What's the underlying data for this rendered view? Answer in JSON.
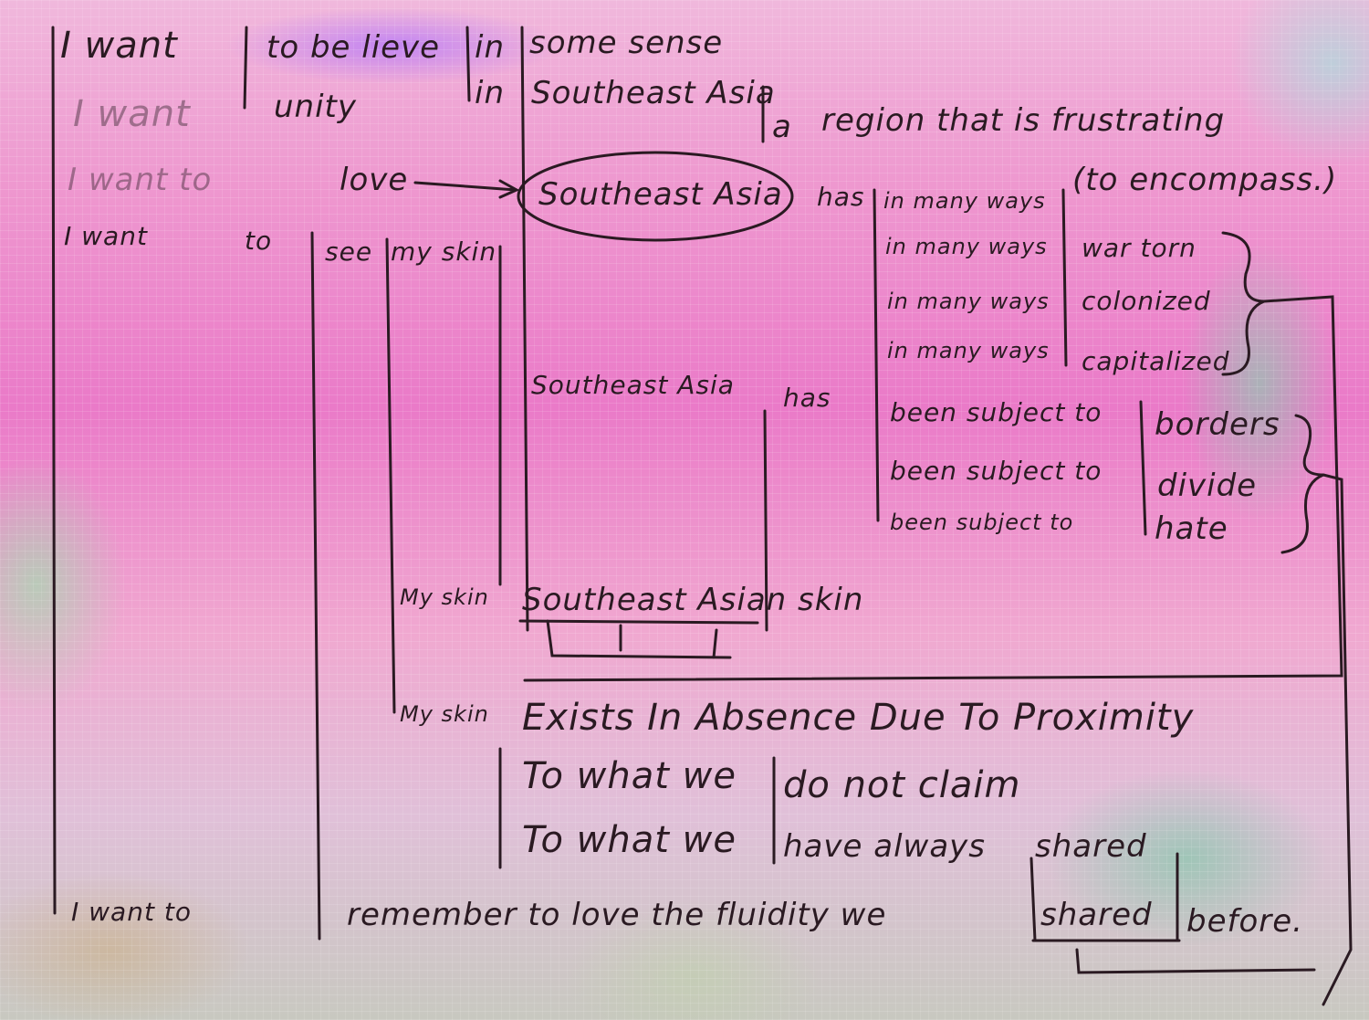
{
  "line1": [
    "I want",
    "to be lieve",
    "in",
    "some sense"
  ],
  "line2": [
    "I want",
    "unity",
    "in",
    "Southeast Asia"
  ],
  "line2b": [
    "a",
    "region that is frustrating"
  ],
  "line3": [
    "I want to",
    "love",
    "Southeast Asia",
    "has",
    "(to encompass.)"
  ],
  "line3b": "in many ways",
  "line4": [
    "I want",
    "to",
    "see",
    "my skin"
  ],
  "ways": [
    [
      "in many ways",
      "war torn"
    ],
    [
      "in many ways",
      "colonized"
    ],
    [
      "in many ways",
      "capitalized"
    ]
  ],
  "sea2": [
    "Southeast Asia",
    "has"
  ],
  "subject": [
    [
      "been subject to",
      "borders"
    ],
    [
      "been subject to",
      "divide"
    ],
    [
      "been subject to",
      "hate"
    ]
  ],
  "skin1": [
    "My skin",
    "Southeast Asian skin"
  ],
  "skin2": [
    "My skin",
    "Exists In Absence Due To Proximity"
  ],
  "what1": [
    "To what we",
    "do not claim"
  ],
  "what2": [
    "To what we",
    "have always",
    "shared"
  ],
  "last": [
    "I want to",
    "remember to love the fluidity we",
    "shared",
    "before."
  ]
}
